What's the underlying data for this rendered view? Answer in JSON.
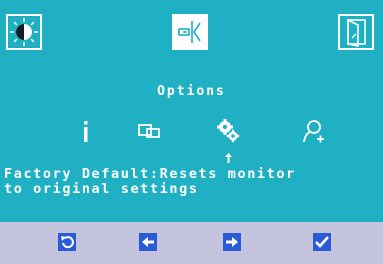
{
  "title": "Options",
  "description": "Factory Default:Resets monitor\nto original settings",
  "tiles": [
    {
      "icon": "brightness-icon",
      "selected": false
    },
    {
      "icon": "input-select-icon",
      "selected": true
    },
    {
      "icon": "exit-icon",
      "selected": false
    }
  ],
  "options": [
    {
      "icon": "info-icon"
    },
    {
      "icon": "window-icon"
    },
    {
      "icon": "factory-default-gear-icon",
      "selected": true
    },
    {
      "icon": "user-add-icon"
    }
  ],
  "nav_buttons": [
    {
      "icon": "back-icon"
    },
    {
      "icon": "left-arrow-icon"
    },
    {
      "icon": "right-arrow-icon"
    },
    {
      "icon": "confirm-check-icon"
    }
  ],
  "colors": {
    "osd_background": "#1fb1c3",
    "nav_background": "#c4c4df",
    "nav_icon": "#2a5bd7",
    "foreground": "#ffffff"
  }
}
